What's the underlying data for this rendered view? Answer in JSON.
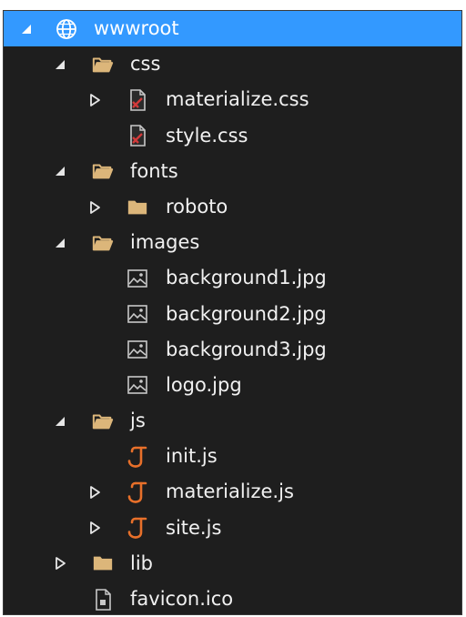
{
  "explorer": {
    "items": [
      {
        "label": "wwwroot",
        "level": 0,
        "icon": "globe-icon",
        "state": "expanded",
        "selected": true
      },
      {
        "label": "css",
        "level": 1,
        "icon": "folder-open-icon",
        "state": "expanded"
      },
      {
        "label": "materialize.css",
        "level": 2,
        "icon": "css-file-icon",
        "state": "collapsed"
      },
      {
        "label": "style.css",
        "level": 2,
        "icon": "css-file-icon",
        "state": "none"
      },
      {
        "label": "fonts",
        "level": 1,
        "icon": "folder-open-icon",
        "state": "expanded"
      },
      {
        "label": "roboto",
        "level": 2,
        "icon": "folder-icon",
        "state": "collapsed"
      },
      {
        "label": "images",
        "level": 1,
        "icon": "folder-open-icon",
        "state": "expanded"
      },
      {
        "label": "background1.jpg",
        "level": 2,
        "icon": "image-file-icon",
        "state": "none"
      },
      {
        "label": "background2.jpg",
        "level": 2,
        "icon": "image-file-icon",
        "state": "none"
      },
      {
        "label": "background3.jpg",
        "level": 2,
        "icon": "image-file-icon",
        "state": "none"
      },
      {
        "label": "logo.jpg",
        "level": 2,
        "icon": "image-file-icon",
        "state": "none"
      },
      {
        "label": "js",
        "level": 1,
        "icon": "folder-open-icon",
        "state": "expanded"
      },
      {
        "label": "init.js",
        "level": 2,
        "icon": "js-file-icon",
        "state": "none"
      },
      {
        "label": "materialize.js",
        "level": 2,
        "icon": "js-file-icon",
        "state": "collapsed"
      },
      {
        "label": "site.js",
        "level": 2,
        "icon": "js-file-icon",
        "state": "collapsed"
      },
      {
        "label": "lib",
        "level": 1,
        "icon": "folder-icon",
        "state": "collapsed"
      },
      {
        "label": "favicon.ico",
        "level": 1,
        "icon": "ico-file-icon",
        "state": "none"
      }
    ]
  },
  "colors": {
    "background": "#1e1e1e",
    "selection": "#3399ff",
    "text": "#f1f1f1",
    "folder": "#dcb67a",
    "js": "#e8702a",
    "css_accent": "#d23a3a",
    "icon_gray": "#c8c8c8"
  }
}
